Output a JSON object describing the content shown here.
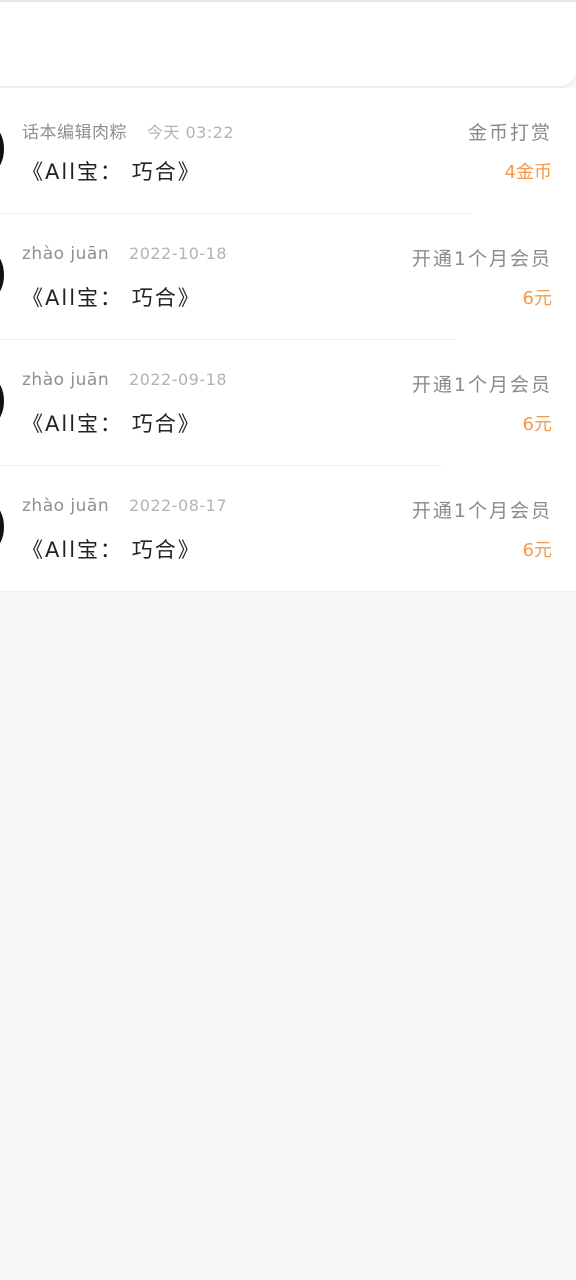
{
  "colors": {
    "page_background": "#f7f6f6",
    "card_background": "#ffffff",
    "accent_amount": "#f39a4a"
  },
  "records": [
    {
      "user": "话本编辑肉粽",
      "time": "今天 03:22",
      "title": "《All宝：  巧合》",
      "action": "金币打赏",
      "amount": "4金币"
    },
    {
      "user": "zhào juān",
      "time": "2022-10-18",
      "title": "《All宝：  巧合》",
      "action": "开通1个月会员",
      "amount": "6元"
    },
    {
      "user": "zhào juān",
      "time": "2022-09-18",
      "title": "《All宝：  巧合》",
      "action": "开通1个月会员",
      "amount": "6元"
    },
    {
      "user": "zhào juān",
      "time": "2022-08-17",
      "title": "《All宝：  巧合》",
      "action": "开通1个月会员",
      "amount": "6元"
    }
  ]
}
